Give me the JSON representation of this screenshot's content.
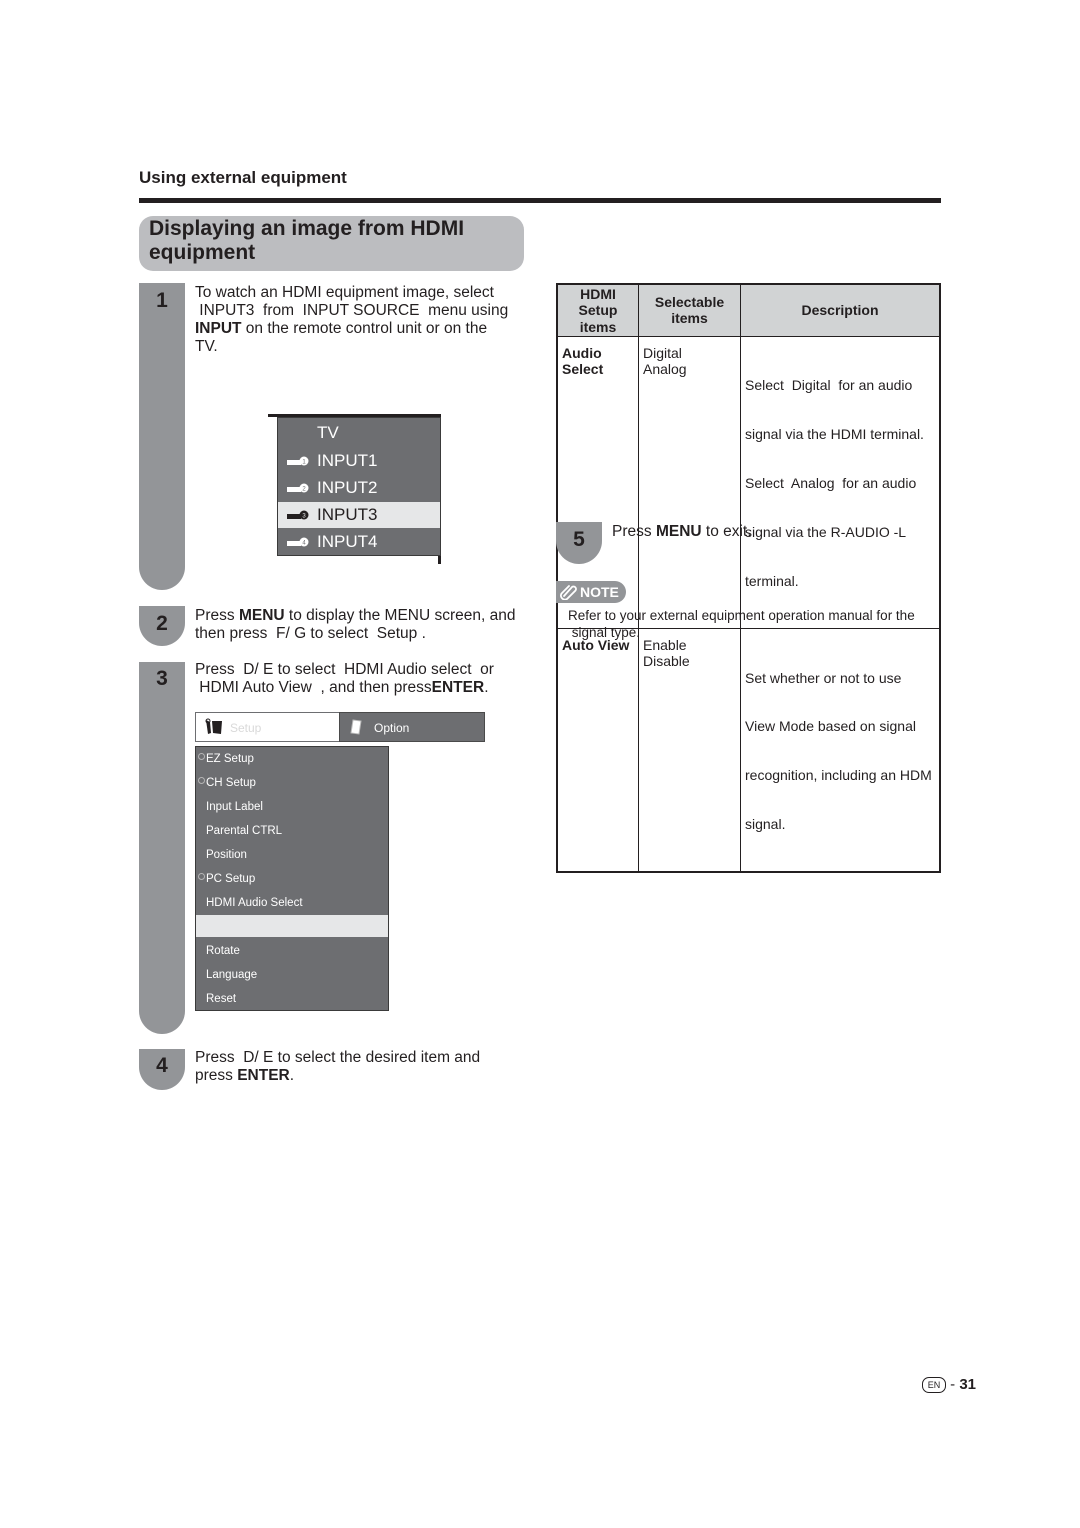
{
  "section_label": "Using external equipment",
  "title_line1": "Displaying an image from HDMI",
  "title_line2": "equipment",
  "steps": [
    {
      "num": "1",
      "lines": [
        "To watch an HDMI equipment image, select",
        " INPUT3  from  INPUT SOURCE  menu using"
      ],
      "bold_word": "INPUT",
      "line3_rest": " on the remote control unit or on the",
      "line4": "TV."
    },
    {
      "num": "2",
      "pre": "Press ",
      "bold": "MENU",
      "line1_rest": " to display the MENU screen, and",
      "line2": "then press  F/ G to select  Setup ."
    },
    {
      "num": "3",
      "line1": "Press  D/ E to select  HDMI Audio select  or",
      "line2_pre": " HDMI Auto View  , and then press",
      "bold": "ENTER",
      "line2_post": "."
    },
    {
      "num": "4",
      "line1": "Press  D/ E to select the desired item and",
      "line2_pre": "press ",
      "bold": "ENTER",
      "line2_post": "."
    },
    {
      "num": "5",
      "pre": "Press ",
      "bold": "MENU",
      "post": " to exit."
    }
  ],
  "input_menu": {
    "items": [
      {
        "label": "TV",
        "icon": ""
      },
      {
        "label": "INPUT1",
        "icon": "input-plug-1-icon"
      },
      {
        "label": "INPUT2",
        "icon": "input-plug-2-icon"
      },
      {
        "label": "INPUT3",
        "icon": "input-plug-3-icon",
        "selected": true
      },
      {
        "label": "INPUT4",
        "icon": "input-plug-4-icon"
      }
    ]
  },
  "setup_menu": {
    "tabs": [
      {
        "label": "Setup",
        "icon": "setup-tools-icon",
        "active": true
      },
      {
        "label": "Option",
        "icon": "option-card-icon",
        "active": false
      }
    ],
    "items": [
      {
        "label": "EZ Setup",
        "lock": true
      },
      {
        "label": "CH Setup",
        "lock": true
      },
      {
        "label": "Input Label",
        "lock": false
      },
      {
        "label": "Parental CTRL",
        "lock": false
      },
      {
        "label": "Position",
        "lock": false
      },
      {
        "label": "PC Setup",
        "lock": true
      },
      {
        "label": "HDMI Audio Select",
        "lock": false
      },
      {
        "label": "",
        "lock": false,
        "selected": true
      },
      {
        "label": "Rotate",
        "lock": false
      },
      {
        "label": "Language",
        "lock": false
      },
      {
        "label": "Reset",
        "lock": false
      }
    ]
  },
  "table": {
    "headers": [
      "HDMI Setup items",
      "Selectable items",
      "Description"
    ],
    "header_lines": [
      [
        "HDMI",
        "Setup",
        "items"
      ],
      [
        "Selectable",
        "items"
      ],
      [
        "Description"
      ]
    ],
    "rows": [
      {
        "key": [
          "Audio",
          "Select"
        ],
        "options": [
          "Digital",
          "Analog"
        ],
        "description": [
          "Select  Digital  for an audio",
          "signal via the HDMI terminal.",
          "Select  Analog  for an audio",
          "signal via the R-AUDIO -L",
          "terminal."
        ]
      },
      {
        "key": [
          "Auto View"
        ],
        "options": [
          "Enable",
          "Disable"
        ],
        "description": [
          "Set whether or not to use",
          "View Mode based on signal",
          "recognition, including an HDM",
          "signal."
        ]
      }
    ]
  },
  "note": {
    "badge": "NOTE",
    "text_line1": "Refer to your external equipment operation manual for the",
    "text_line2": " signal type."
  },
  "footer": {
    "lang": "EN",
    "separator": " - ",
    "page": "31"
  },
  "colors": {
    "step_gray": "#939598",
    "title_gray": "#bcbdc0",
    "menu_gray": "#6d6e71",
    "highlight": "#e6e7e8",
    "text": "#231f20"
  }
}
